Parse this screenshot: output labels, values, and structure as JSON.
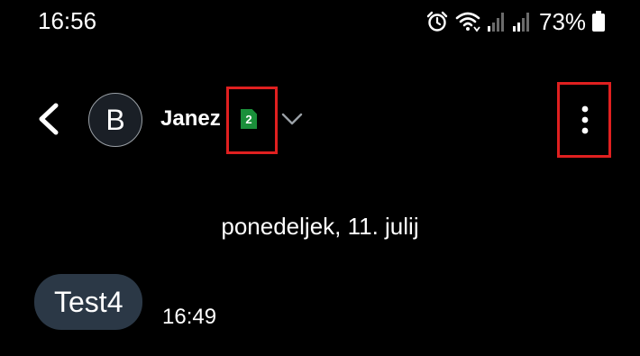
{
  "status_bar": {
    "time": "16:56",
    "battery_percent": "73%",
    "icons": [
      "alarm-icon",
      "wifi-icon",
      "signal-icon",
      "signal-icon",
      "battery-icon"
    ]
  },
  "header": {
    "contact_initial": "B",
    "contact_name": "Janez",
    "sim_badge": "2",
    "icons": [
      "back-arrow-icon",
      "chevron-down-icon",
      "more-vertical-icon"
    ]
  },
  "conversation": {
    "date_separator": "ponedeljek, 11. julij",
    "messages": [
      {
        "text": "Test4",
        "time": "16:49"
      }
    ]
  },
  "colors": {
    "background": "#000000",
    "bubble": "#2b3846",
    "sim_badge": "#1a8f3a",
    "highlight": "#e02020"
  }
}
